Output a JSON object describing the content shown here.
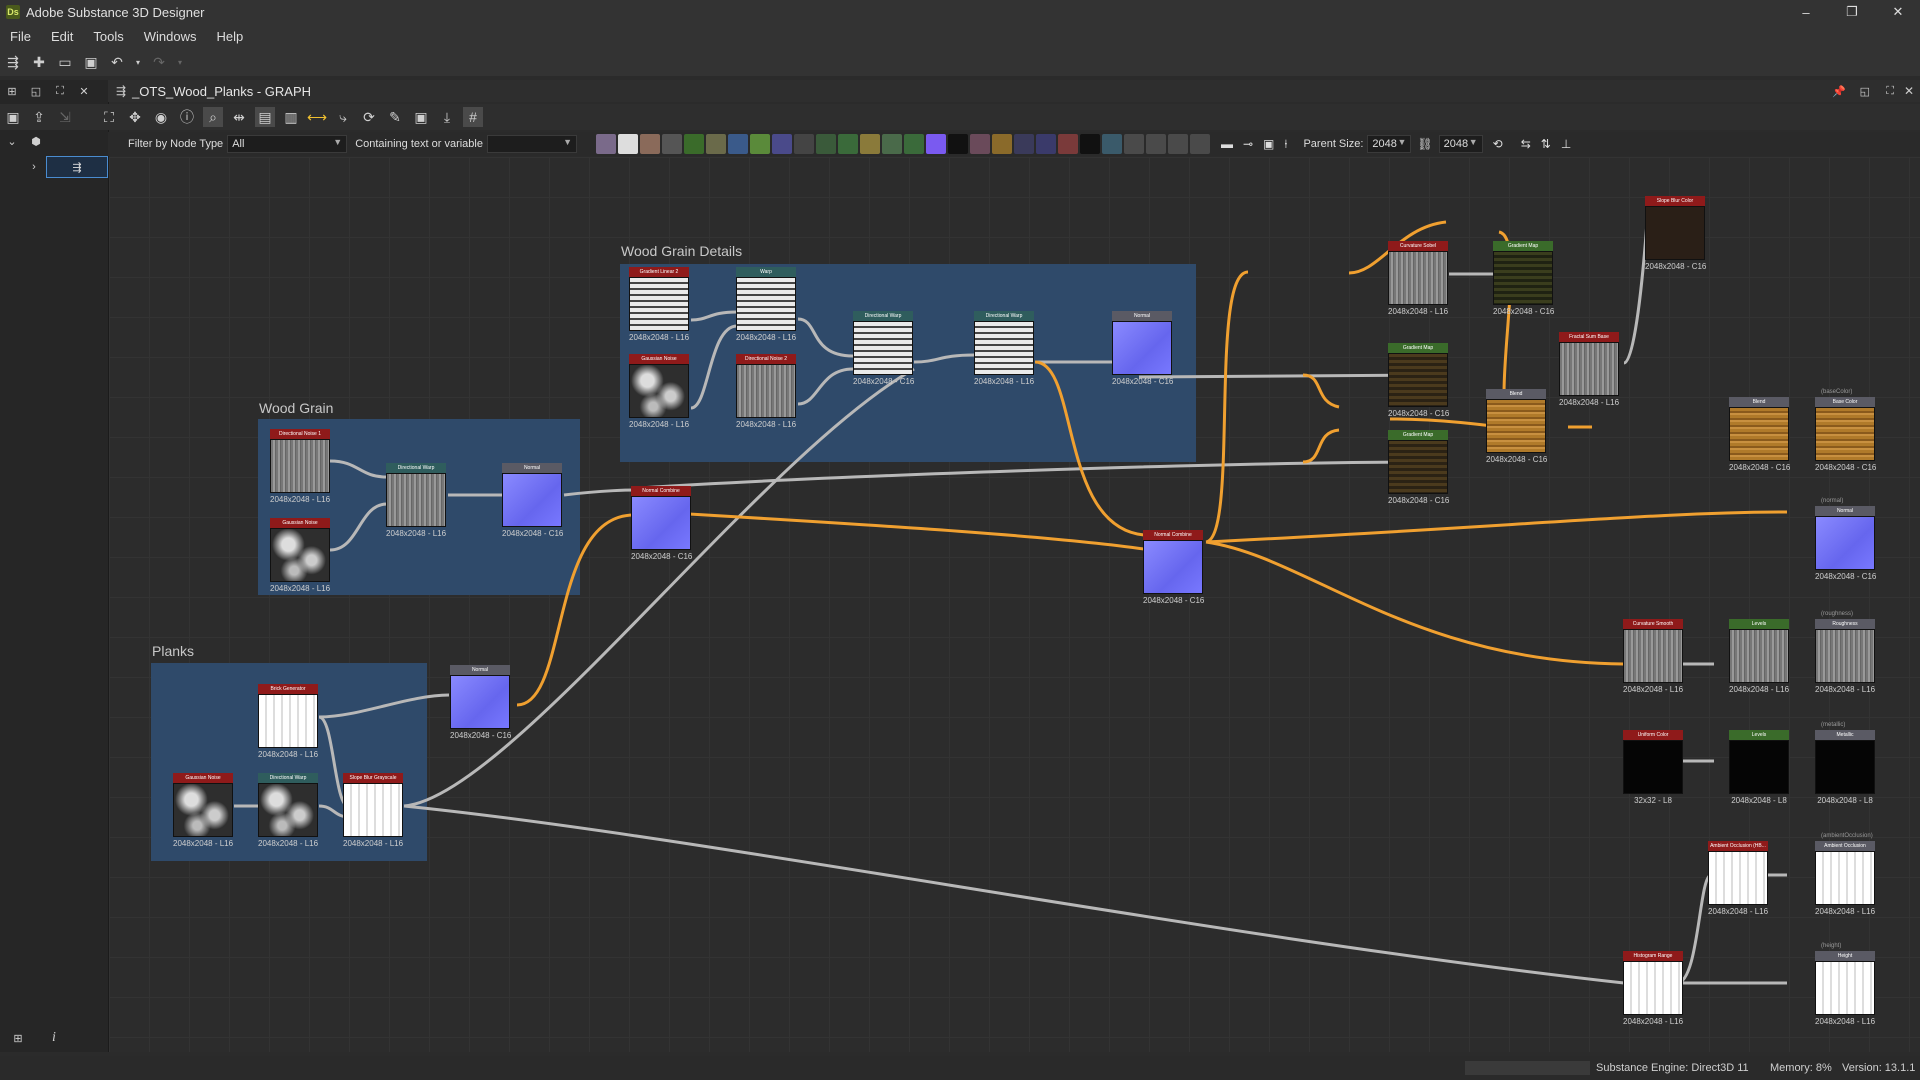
{
  "app": {
    "title": "Adobe Substance 3D Designer",
    "logo_text": "Ds"
  },
  "window_controls": {
    "minimize": "–",
    "maximize": "❐",
    "close": "✕"
  },
  "menu": [
    {
      "label": "File",
      "accel": "F"
    },
    {
      "label": "Edit",
      "accel": "E"
    },
    {
      "label": "Tools",
      "accel": "T"
    },
    {
      "label": "Windows",
      "accel": "W"
    },
    {
      "label": "Help",
      "accel": "H"
    }
  ],
  "graph": {
    "title": "_OTS_Wood_Planks - GRAPH"
  },
  "filter": {
    "label": "Filter by Node Type",
    "value": "All",
    "text_label": "Containing text or variable",
    "text_value": ""
  },
  "parent_size": {
    "label": "Parent Size:",
    "w": "2048",
    "h": "2048"
  },
  "frames": {
    "wood_grain_details": "Wood Grain Details",
    "wood_grain": "Wood Grain",
    "planks": "Planks"
  },
  "nodes": {
    "n1": {
      "title": "Gradient Linear 2",
      "label": "2048x2048 - L16"
    },
    "n2": {
      "title": "Warp",
      "label": "2048x2048 - L16"
    },
    "n3": {
      "title": "Gaussian Noise",
      "label": "2048x2048 - L16"
    },
    "n4": {
      "title": "Directional Noise 2",
      "label": "2048x2048 - L16"
    },
    "n5": {
      "title": "Directional Warp",
      "label": "2048x2048 - C16"
    },
    "n6": {
      "title": "Directional Warp",
      "label": "2048x2048 - L16"
    },
    "n7": {
      "title": "Normal",
      "label": "2048x2048 - C16"
    },
    "n8": {
      "title": "Directional Noise 1",
      "label": "2048x2048 - L16"
    },
    "n9": {
      "title": "Gaussian Noise",
      "label": "2048x2048 - L16"
    },
    "n10": {
      "title": "Directional Warp",
      "label": "2048x2048 - L16"
    },
    "n11": {
      "title": "Normal",
      "label": "2048x2048 - C16"
    },
    "n12": {
      "title": "Normal Combine",
      "label": "2048x2048 - C16"
    },
    "n13": {
      "title": "Brick Generator",
      "label": "2048x2048 - L16"
    },
    "n14": {
      "title": "Normal",
      "label": "2048x2048 - C16"
    },
    "n15": {
      "title": "Gaussian Noise",
      "label": "2048x2048 - L16"
    },
    "n16": {
      "title": "Directional Warp",
      "label": "2048x2048 - L16"
    },
    "n17": {
      "title": "Slope Blur Grayscale",
      "label": "2048x2048 - L16"
    },
    "n18": {
      "title": "Normal Combine",
      "label": "2048x2048 - C16"
    },
    "n19": {
      "title": "Curvature Sobel",
      "label": "2048x2048 - L16"
    },
    "n20": {
      "title": "Gradient Map",
      "label": "2048x2048 - C16"
    },
    "n21": {
      "title": "Slope Blur Color",
      "label": "2048x2048 - C16"
    },
    "n22": {
      "title": "Gradient Map",
      "label": "2048x2048 - C16"
    },
    "n23": {
      "title": "Fractal Sum Base",
      "label": "2048x2048 - L16"
    },
    "n24": {
      "title": "Blend",
      "label": "2048x2048 - C16"
    },
    "n25": {
      "title": "Gradient Map",
      "label": "2048x2048 - C16"
    },
    "n26": {
      "title": "Blend",
      "label": "2048x2048 - C16"
    },
    "n27": {
      "title": "Base Color",
      "sub": "(baseColor)",
      "label": "2048x2048 - C16"
    },
    "n28": {
      "title": "Normal",
      "sub": "(normal)",
      "label": "2048x2048 - C16"
    },
    "n29": {
      "title": "Curvature Smooth",
      "label": "2048x2048 - L16"
    },
    "n30": {
      "title": "Levels",
      "label": "2048x2048 - L16"
    },
    "n31": {
      "title": "Roughness",
      "sub": "(roughness)",
      "label": "2048x2048 - L16"
    },
    "n32": {
      "title": "Uniform Color",
      "label": "32x32 - L8"
    },
    "n33": {
      "title": "Levels",
      "label": "2048x2048 - L8"
    },
    "n34": {
      "title": "Metallic",
      "sub": "(metallic)",
      "label": "2048x2048 - L8"
    },
    "n35": {
      "title": "Ambient Occlusion (HB...",
      "label": "2048x2048 - L16"
    },
    "n36": {
      "title": "Ambient Occlusion",
      "sub": "(ambientOcclusion)",
      "label": "2048x2048 - L16"
    },
    "n37": {
      "title": "Histogram Range",
      "label": "2048x2048 - L16"
    },
    "n38": {
      "title": "Height",
      "sub": "(height)",
      "label": "2048x2048 - L16"
    }
  },
  "colors": {
    "orange_link": "#f0a030",
    "grey_link": "#b8b8b8",
    "frame": "#2f4a6a"
  },
  "status": {
    "engine": "Substance Engine: Direct3D 11",
    "memory": "Memory: 8%",
    "version": "Version: 13.1.1"
  }
}
